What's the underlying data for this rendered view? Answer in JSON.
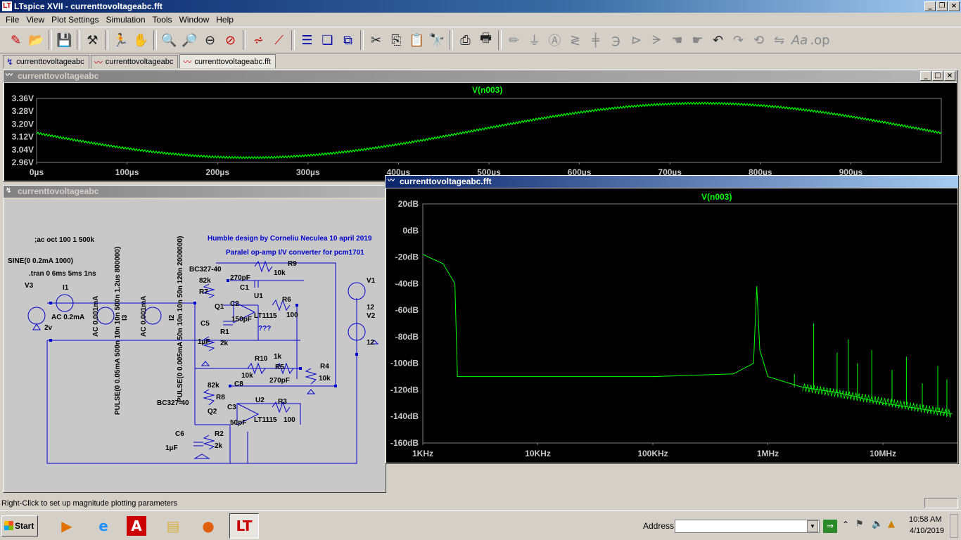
{
  "window": {
    "title": "LTspice XVII - currenttovoltageabc.fft",
    "controls": [
      "_",
      "❐",
      "×"
    ]
  },
  "menu": [
    "File",
    "View",
    "Plot Settings",
    "Simulation",
    "Tools",
    "Window",
    "Help"
  ],
  "toolbar_icons": [
    "new-schematic-icon",
    "open-icon",
    "save-icon",
    "control-panel-icon",
    "run-icon",
    "halt-icon",
    "zoom-in-icon",
    "zoom-out-icon",
    "zoom-fit-icon",
    "zoom-cancel-icon",
    "autorange-icon",
    "mark-icon",
    "tile-horizontal-icon",
    "cascade-icon",
    "tile-vertical-icon",
    "cut-icon",
    "copy-icon",
    "paste-icon",
    "find-icon",
    "print-icon",
    "print-setup-icon",
    "wire-icon",
    "ground-icon",
    "label-icon",
    "resistor-icon",
    "capacitor-icon",
    "inductor-icon",
    "diode-icon",
    "component-icon",
    "move-icon",
    "drag-icon",
    "undo-icon",
    "redo-icon",
    "rotate-icon",
    "mirror-icon",
    "text-icon",
    "spice-directive-icon"
  ],
  "tabs": [
    {
      "label": "currenttovoltageabc",
      "icon": "schematic-icon"
    },
    {
      "label": "currenttovoltageabc",
      "icon": "waveform-icon"
    },
    {
      "label": "currenttovoltageabc.fft",
      "icon": "waveform-icon"
    }
  ],
  "waveform_window": {
    "title": "currenttovoltageabc",
    "trace": "V(n003)",
    "y_ticks": [
      "3.36V",
      "3.28V",
      "3.20V",
      "3.12V",
      "3.04V",
      "2.96V"
    ],
    "x_ticks": [
      "0µs",
      "100µs",
      "200µs",
      "300µs",
      "400µs",
      "500µs",
      "600µs",
      "700µs",
      "800µs",
      "900µs"
    ],
    "colors": {
      "background": "#000000",
      "trace": "#00ff00",
      "grid": "#808080"
    }
  },
  "schematic_window": {
    "title": "currenttovoltageabc",
    "directives": [
      ";ac oct 100 1 500k",
      "SINE(0 0.2mA 1000)",
      ".tran 0 6ms 5ms 1ns"
    ],
    "notes": [
      "Humble design by Corneliu Neculea 10 april  2019",
      "Paralel op-amp I/V converter  for pcm1701",
      "???"
    ],
    "labels": [
      "V3",
      "2v",
      "I1",
      "AC 0.2mA",
      "AC 0.001mA",
      "I3",
      "AC 0.001mA",
      "I2",
      "PULSE(0 0.05mA 500n 10n 10n 500n 1.2us 800000)",
      "PULSE(0 0.005mA 50n 10n 10n 50n 120n 2000000)",
      "BC327-40",
      "R9",
      "10k",
      "270pF",
      "82k",
      "R7",
      "C1",
      "U1",
      "Q1",
      "C2",
      "R6",
      "150pF",
      "LT1115",
      "100",
      "C5",
      "R1",
      "1µF",
      "2k",
      "V1",
      "12",
      "V2",
      "12",
      "R10",
      "1k",
      "R5",
      "R4",
      "10k",
      "10k",
      "270pF",
      "82k",
      "C8",
      "R8",
      "BC327-40",
      "Q2",
      "C3",
      "U2",
      "R3",
      "50pF",
      "LT1115",
      "100",
      "C6",
      "1µF",
      "R2",
      "2k"
    ]
  },
  "fft_window": {
    "title": "currenttovoltageabc.fft",
    "trace": "V(n003)",
    "y_ticks": [
      "20dB",
      "0dB",
      "-20dB",
      "-40dB",
      "-60dB",
      "-80dB",
      "-100dB",
      "-120dB",
      "-140dB",
      "-160dB"
    ],
    "x_ticks": [
      "1KHz",
      "10KHz",
      "100KHz",
      "1MHz",
      "10MHz"
    ]
  },
  "status": {
    "text": "Right-Click to set up magnitude plotting parameters"
  },
  "taskbar": {
    "start": "Start",
    "apps": [
      "media-player-icon",
      "internet-explorer-icon",
      "acrobat-icon",
      "file-explorer-icon",
      "firefox-icon",
      "ltspice-icon"
    ],
    "address_label": "Address",
    "address_value": "",
    "time": "10:58 AM",
    "date": "4/10/2019"
  },
  "chart_data": [
    {
      "type": "line",
      "title": "V(n003)",
      "xlabel": "",
      "ylabel": "",
      "xlim": [
        0,
        1000
      ],
      "ylim": [
        2.96,
        3.36
      ],
      "x_unit": "µs",
      "series": [
        {
          "name": "V(n003)",
          "x": [
            0,
            100,
            200,
            250,
            300,
            400,
            500,
            600,
            700,
            750,
            800,
            900,
            1000
          ],
          "values": [
            3.14,
            3.07,
            3.0,
            2.99,
            3.0,
            3.07,
            3.16,
            3.25,
            3.32,
            3.33,
            3.32,
            3.25,
            3.15
          ]
        }
      ],
      "grid": false
    },
    {
      "type": "line",
      "title": "V(n003)",
      "xlabel": "",
      "ylabel": "",
      "xscale": "log",
      "xlim": [
        1000,
        40000000
      ],
      "ylim": [
        -160,
        20
      ],
      "series": [
        {
          "name": "V(n003)",
          "x": [
            1000,
            1500,
            1900,
            2000,
            10000,
            100000,
            500000,
            750000,
            800000,
            850000,
            1000000,
            2000000,
            4000000,
            10000000,
            40000000
          ],
          "values": [
            -18,
            -25,
            -40,
            -110,
            -110,
            -110,
            -108,
            -100,
            -42,
            -90,
            -110,
            -118,
            -122,
            -130,
            -138
          ]
        }
      ],
      "grid": false
    }
  ]
}
